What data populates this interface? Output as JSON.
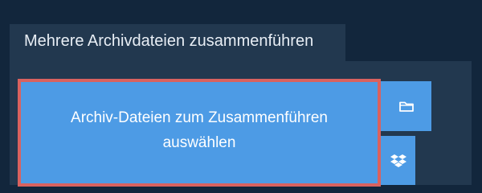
{
  "tab": {
    "title": "Mehrere Archivdateien zusammenführen"
  },
  "upload": {
    "label": "Archiv-Dateien zum Zusammenführen auswählen"
  },
  "side_buttons": {
    "folder_icon": "folder-icon",
    "dropbox_icon": "dropbox-icon"
  },
  "colors": {
    "page_background": "#12263c",
    "panel_background": "#22384f",
    "button_blue": "#4d9be5",
    "highlight_border": "#d9625f",
    "text_white": "#ffffff"
  }
}
